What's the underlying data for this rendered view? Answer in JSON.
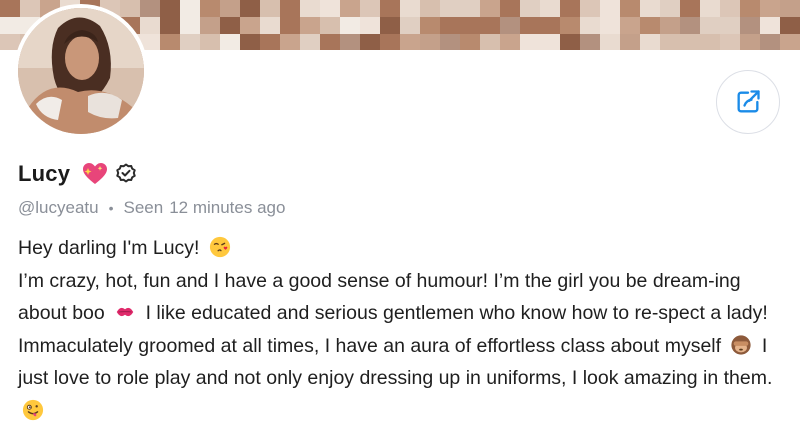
{
  "profile": {
    "name": "Lucy",
    "handle": "@lucyeatu",
    "seen_label": "Seen",
    "seen_time": "12 minutes ago",
    "separator": "•"
  },
  "bio": {
    "greeting": "Hey darling I'm Lucy!",
    "greeting_emoji": "face-blowing-kiss",
    "segment_1": "I’m crazy, hot, fun and I have a good sense of humour! I’m the girl you be dream-ing about boo",
    "segment_1_emoji": "kiss-mark",
    "segment_2": "I like educated and serious gentlemen who know how to re-spect a lady! Immaculately groomed at all times, I have an aura of effortless class about myself",
    "segment_2_emoji": "see-no-evil-monkey",
    "segment_3": "I just love to role play and not only enjoy dressing up in uniforms, I look amazing in them.",
    "segment_3_emoji": "zany-face"
  },
  "icons": {
    "heart": "sparkling-heart-icon",
    "verified": "verified-badge-icon",
    "share": "share-icon"
  },
  "colors": {
    "accent": "#1a8be8",
    "muted_text": "#8a8f98",
    "heart": "#e8457a",
    "share_border": "#dcdfe6"
  }
}
